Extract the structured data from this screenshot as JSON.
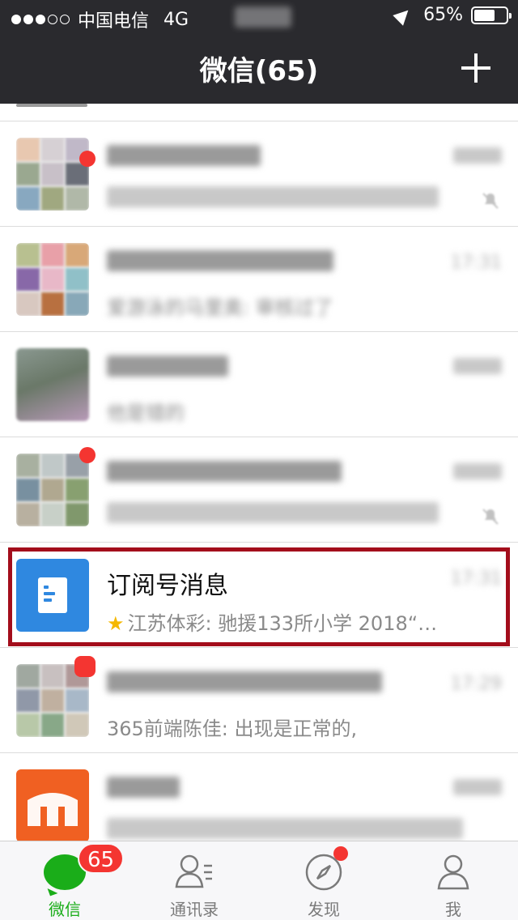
{
  "status_bar": {
    "carrier": "中国电信",
    "network": "4G",
    "battery": "65%",
    "battery_level": 0.65
  },
  "nav": {
    "title": "微信(65)"
  },
  "chats": [
    {
      "name": "",
      "preview": "",
      "time": ""
    },
    {
      "name": "",
      "preview": "爱游泳的马里奥: 审核过了",
      "time": "17:31"
    },
    {
      "name": "",
      "preview": "他是错的",
      "time": ""
    },
    {
      "name": "",
      "preview": "",
      "time": ""
    },
    {
      "name": "订阅号消息",
      "preview": "江苏体彩: 驰援133所小学 2018“…",
      "time": "17:31"
    },
    {
      "name": "",
      "preview": "365前端陈佳: 出现是正常的,",
      "time": "17:29"
    },
    {
      "name": "",
      "preview": "",
      "time": ""
    }
  ],
  "tabbar": {
    "tabs": [
      {
        "label": "微信",
        "badge": "65"
      },
      {
        "label": "通讯录"
      },
      {
        "label": "发现"
      },
      {
        "label": "我"
      }
    ]
  },
  "colors": {
    "nav_bg": "#2a2a2e",
    "accent_green": "#1aad19",
    "badge_red": "#f43531",
    "highlight_border": "#a30d1b",
    "subscription_blue": "#2f88e0"
  }
}
